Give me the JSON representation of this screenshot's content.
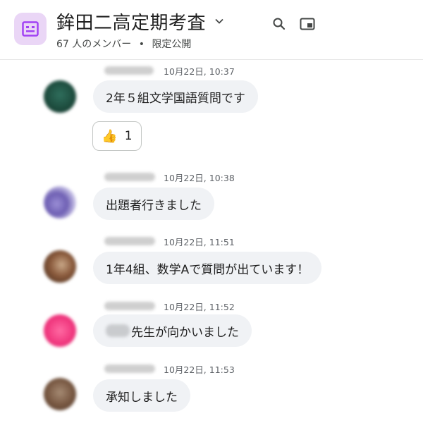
{
  "header": {
    "title": "鉾田二高定期考査",
    "members": "67 人のメンバー",
    "separator": "•",
    "visibility": "限定公開"
  },
  "messages": [
    {
      "time": "10月22日, 10:37",
      "text": "2年５組文学国語質問です",
      "reaction": {
        "emoji": "👍",
        "count": "1"
      }
    },
    {
      "time": "10月22日, 10:38",
      "text": "出題者行きました"
    },
    {
      "time": "10月22日, 11:51",
      "text": "1年4組、数学Aで質問が出ています！"
    },
    {
      "time": "10月22日, 11:52",
      "text": "先生が向かいました"
    },
    {
      "time": "10月22日, 11:53",
      "text": "承知しました"
    }
  ],
  "colors": {
    "space_icon_bg": "#ead6f6",
    "space_icon_fg": "#a142f4",
    "bubble_bg": "#f0f2f5"
  }
}
